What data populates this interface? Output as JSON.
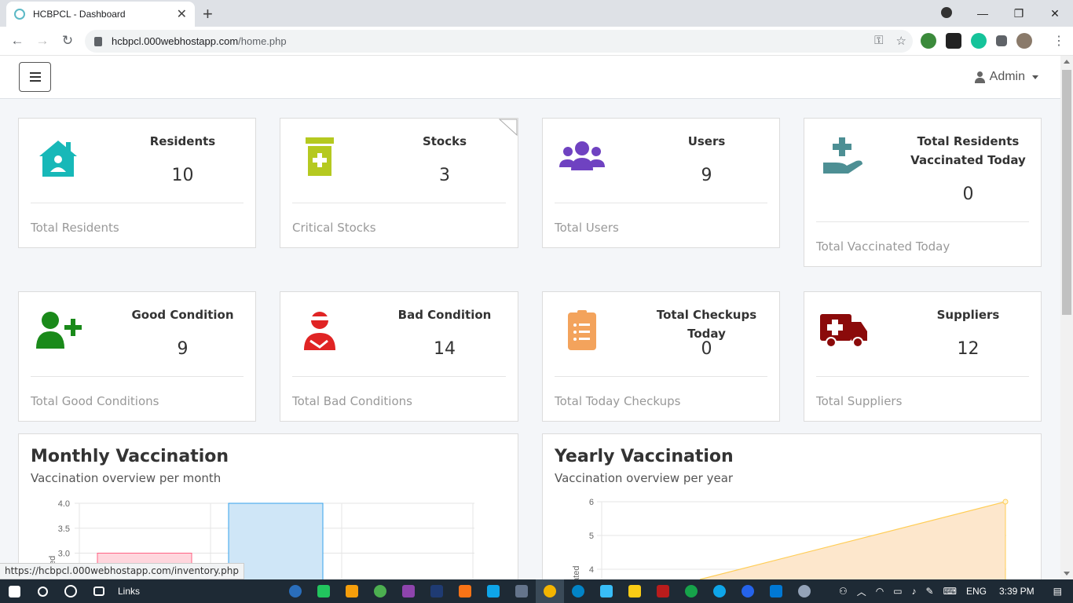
{
  "browser": {
    "tab_title": "HCBPCL - Dashboard",
    "new_tab": "+",
    "tab_close": "✕",
    "url_host": "hcbpcl.000webhostapp.com",
    "url_path": "/home.php",
    "window_minimize": "—",
    "window_restore": "❐",
    "window_close": "✕"
  },
  "header": {
    "admin_label": "Admin"
  },
  "cards": [
    {
      "title": "Residents",
      "value": "10",
      "footer": "Total Residents",
      "icon": "house-user-icon",
      "color": "#17b8b8"
    },
    {
      "title": "Stocks",
      "value": "3",
      "footer": "Critical Stocks",
      "icon": "prescription-bottle-icon",
      "color": "#b5c920"
    },
    {
      "title": "Users",
      "value": "9",
      "footer": "Total Users",
      "icon": "users-icon",
      "color": "#6f42c1"
    },
    {
      "title": "Total Residents Vaccinated Today",
      "value": "0",
      "footer": "Total Vaccinated Today",
      "icon": "hand-holding-medical-icon",
      "color": "#4d8f94"
    },
    {
      "title": "Good Condition",
      "value": "9",
      "footer": "Total Good Conditions",
      "icon": "user-plus-icon",
      "color": "#1a8a1a"
    },
    {
      "title": "Bad Condition",
      "value": "14",
      "footer": "Total Bad Conditions",
      "icon": "user-injured-icon",
      "color": "#e02424"
    },
    {
      "title": "Total Checkups Today",
      "value": "0",
      "footer": "Total Today Checkups",
      "icon": "clipboard-list-icon",
      "color": "#f3a35c"
    },
    {
      "title": "Suppliers",
      "value": "12",
      "footer": "Total Suppliers",
      "icon": "ambulance-icon",
      "color": "#8b0a0a"
    }
  ],
  "monthly": {
    "title": "Monthly Vaccination",
    "subtitle": "Vaccination overview per month"
  },
  "yearly": {
    "title": "Yearly Vaccination",
    "subtitle": "Vaccination overview per year"
  },
  "chart_data": [
    {
      "type": "bar",
      "title": "Monthly Vaccination",
      "ylabel": "ed",
      "ylim": [
        3.0,
        4.0
      ],
      "yticks": [
        "4.0",
        "3.5",
        "3.0"
      ],
      "series": [
        {
          "values": [
            3.0,
            4.0
          ],
          "colors": [
            "#ffd6dd",
            "#cfe6f7"
          ],
          "borders": [
            "#ff6384",
            "#36a2eb"
          ]
        }
      ]
    },
    {
      "type": "area",
      "title": "Yearly Vaccination",
      "ylabel": "nated",
      "ylim": [
        4,
        6
      ],
      "yticks": [
        "6",
        "5",
        "4"
      ],
      "series": [
        {
          "values": [
            0,
            6
          ],
          "color": "#ffcd56",
          "fill": "#fde7cc"
        }
      ]
    }
  ],
  "status_url": "https://hcbpcl.000webhostapp.com/inventory.php",
  "taskbar": {
    "links_label": "Links",
    "lang": "ENG",
    "time": "3:39 PM"
  }
}
